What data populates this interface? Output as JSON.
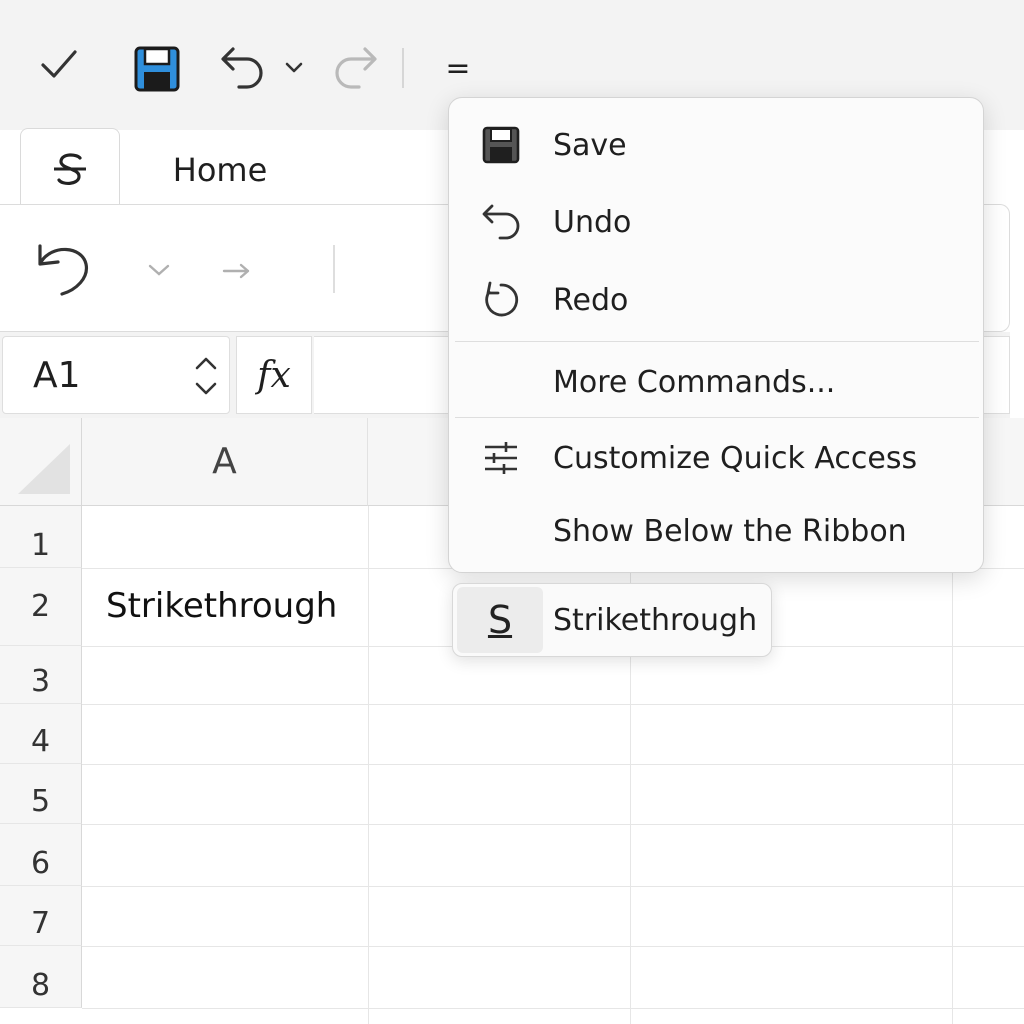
{
  "quick_access": {
    "icons": [
      "check-icon",
      "save-icon",
      "undo-icon",
      "chevron-down-icon",
      "redo-icon",
      "customize-qat-icon"
    ],
    "customize_glyph": "="
  },
  "ribbon": {
    "tabs": [
      {
        "name": "strikethrough-tab",
        "icon": "strikethrough-s-icon"
      },
      {
        "name": "home-tab",
        "label": "Home"
      }
    ]
  },
  "formula_bar": {
    "name_box": "A1",
    "fx_label": "fx",
    "formula_value": ""
  },
  "grid": {
    "columns": [
      "A"
    ],
    "rows": [
      "1",
      "2",
      "3",
      "4",
      "5",
      "6",
      "7",
      "8"
    ],
    "cells": {
      "A2": "Strikethrough"
    }
  },
  "menu": {
    "items": [
      {
        "label": "Save",
        "icon": "save-icon"
      },
      {
        "label": "Undo",
        "icon": "undo-icon"
      },
      {
        "label": "Redo",
        "icon": "redo-icon"
      },
      {
        "label": "More Commands...",
        "icon": ""
      },
      {
        "label": "Customize Quick Access",
        "icon": "sliders-icon"
      },
      {
        "label": "Show Below the Ribbon",
        "icon": ""
      }
    ]
  },
  "chip": {
    "icon_glyph": "S",
    "label": "Strikethrough"
  },
  "colors": {
    "save_blue": "#2f8fdc",
    "toolbar_bg": "#f3f3f3"
  }
}
